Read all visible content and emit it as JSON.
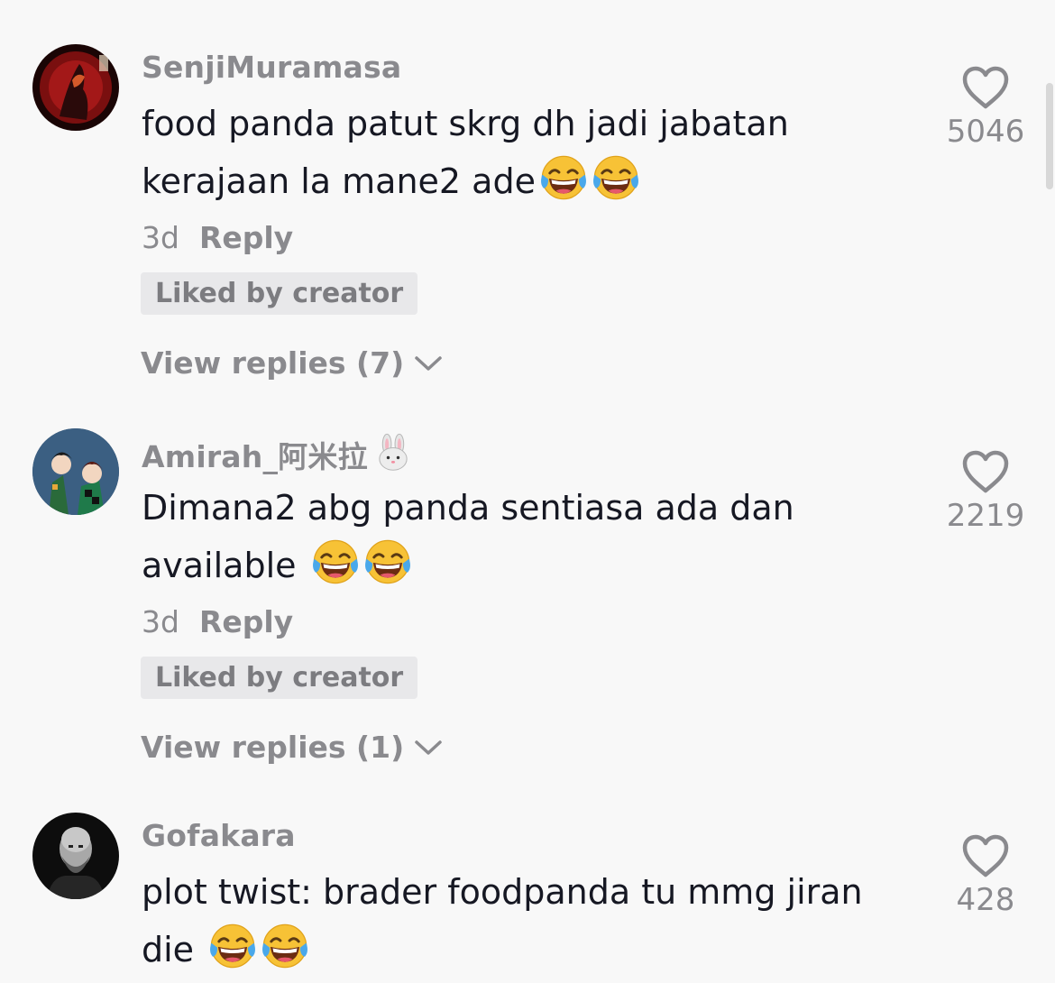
{
  "comments": [
    {
      "username": "SenjiMuramasa",
      "text": "food panda patut skrg dh jadi jabatan kerajaan la mane2 ade",
      "emoji": [
        "face-with-tears-of-joy",
        "face-with-tears-of-joy"
      ],
      "age": "3d",
      "reply_label": "Reply",
      "badge": "Liked by creator",
      "view_replies": "View replies (7)",
      "likes": "5046"
    },
    {
      "username": "Amirah_阿米拉",
      "username_emoji": "rabbit-face",
      "text": "Dimana2 abg panda sentiasa ada dan available ",
      "emoji": [
        "face-with-tears-of-joy",
        "face-with-tears-of-joy"
      ],
      "age": "3d",
      "reply_label": "Reply",
      "badge": "Liked by creator",
      "view_replies": "View replies (1)",
      "likes": "2219"
    },
    {
      "username": "Gofakara",
      "text": "plot twist: brader foodpanda tu mmg jiran die ",
      "emoji": [
        "face-with-tears-of-joy",
        "face-with-tears-of-joy"
      ],
      "likes": "428"
    }
  ],
  "colors": {
    "background": "#f8f8f8",
    "text": "#161823",
    "secondary": "#8a8a8e",
    "badge_bg": "#e8e8ea"
  },
  "icons": {
    "like": "heart-outline-icon",
    "expand": "chevron-down-icon"
  }
}
